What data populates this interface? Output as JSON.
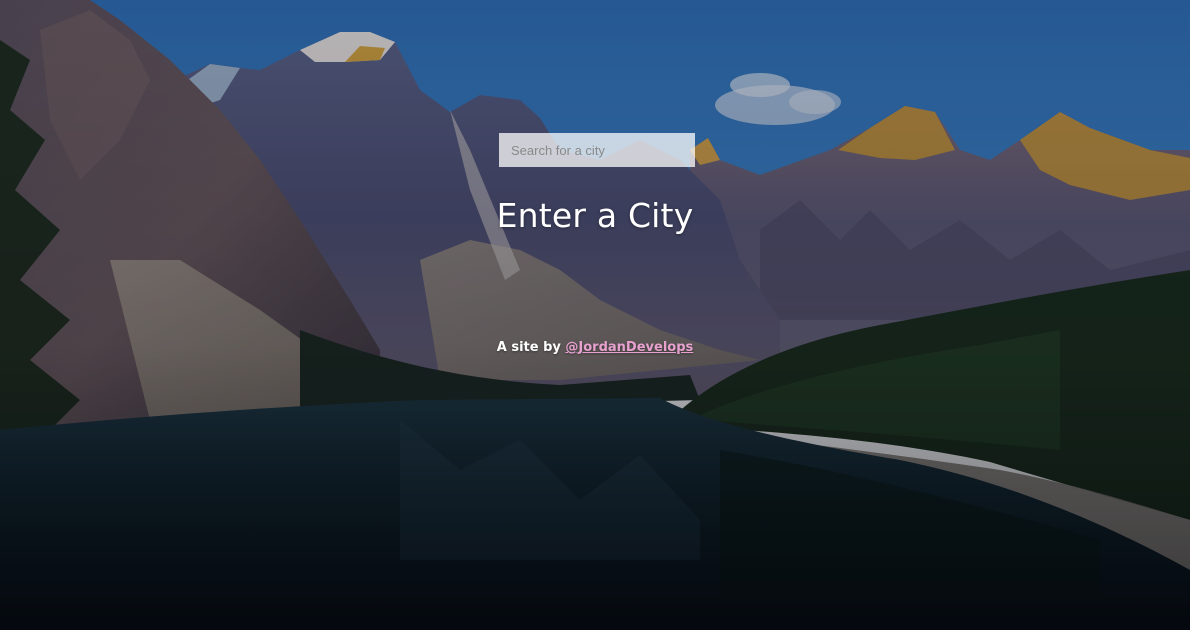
{
  "search": {
    "placeholder": "Search for a city",
    "value": ""
  },
  "title": "Enter a City",
  "credit": {
    "prefix": "A site by ",
    "link_text": "@JordanDevelops"
  },
  "colors": {
    "link": "#e7a1cf",
    "title": "#ffffff"
  },
  "background": {
    "icon": "mountain-lake-photo"
  }
}
